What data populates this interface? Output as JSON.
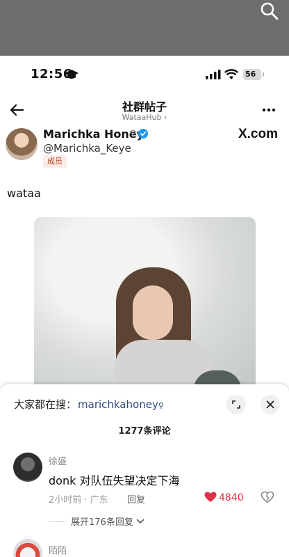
{
  "status": {
    "time": "12:56",
    "battery": "56"
  },
  "nav": {
    "title": "社群帖子",
    "subtitle": "WataaHub ›"
  },
  "author": {
    "name": "Marichka Honey",
    "flake": "❄",
    "handle": "@Marichka_Keye",
    "badge": "成员",
    "source": "X.com"
  },
  "post": {
    "text": "wataa"
  },
  "sheet": {
    "search_prefix": "大家都在搜：",
    "search_term": "marichkahoney",
    "comment_count": "1277条评论"
  },
  "comments": [
    {
      "user": "徐盛",
      "text": "donk 对队伍失望决定下海",
      "time_location": "2小时前 · 广东",
      "reply_label": "回复",
      "likes": "4840",
      "expand_replies": "展开176条回复"
    },
    {
      "user": "陌陌"
    }
  ],
  "colors": {
    "like": "#e0304a",
    "search_term": "#2f4a82",
    "badge_text": "#b44a2e",
    "top_bar": "#6e6e6e"
  }
}
